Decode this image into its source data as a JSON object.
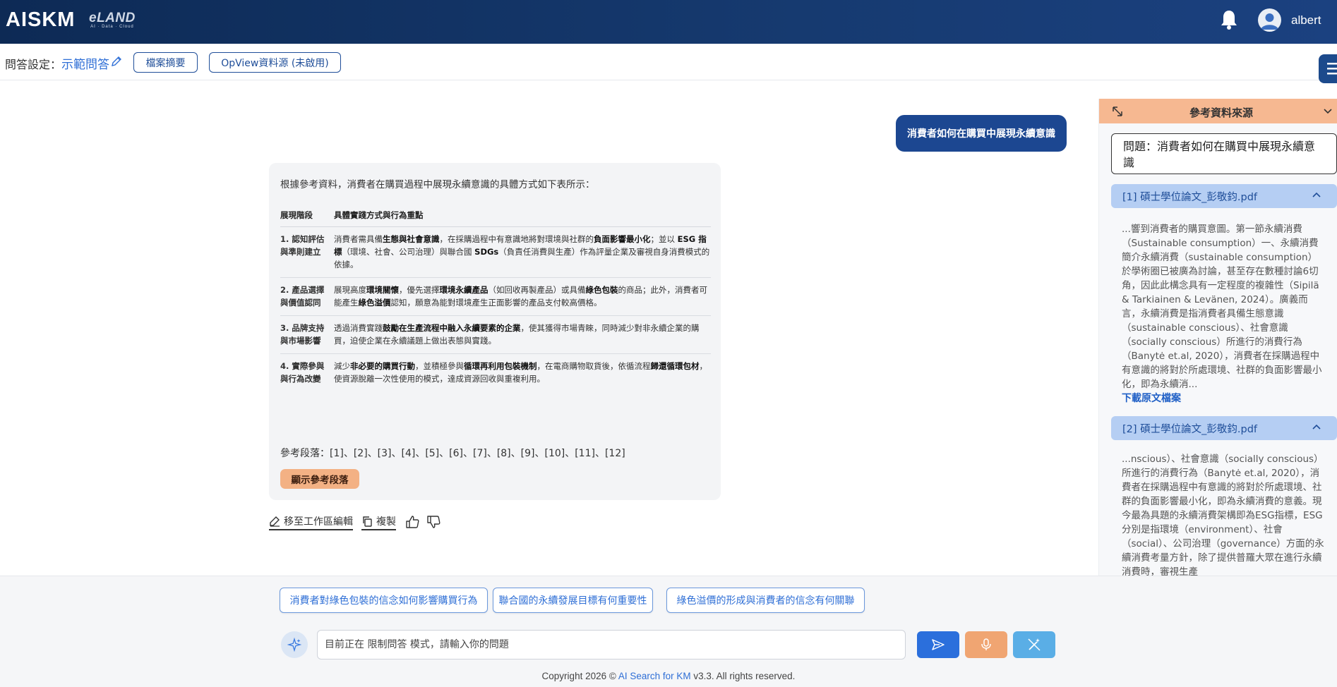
{
  "header": {
    "logo": "AISKM",
    "brand": "eLAND",
    "brand_tagline": "AI · Data · Cloud",
    "username": "albert"
  },
  "settings": {
    "label": "問答設定：",
    "mode_link": "示範問答",
    "summary_button": "檔案摘要",
    "opview_button": "OpView資料源 (未啟用)"
  },
  "chat": {
    "user_question": "消費者如何在購買中展現永續意識",
    "answer_intro": "根據參考資料，消費者在購買過程中展現永續意識的具體方式如下表所示：",
    "table_headers": [
      "展現階段",
      "具體實踐方式與行為重點"
    ],
    "rows": [
      {
        "stage": "1. 認知評估與準則建立",
        "parts": [
          {
            "t": "消費者需具備",
            "b": false
          },
          {
            "t": "生態與社會意識",
            "b": true
          },
          {
            "t": "，在採購過程中有意識地將對環境與社群的",
            "b": false
          },
          {
            "t": "負面影響最小化",
            "b": true
          },
          {
            "t": "；並以 ",
            "b": false
          },
          {
            "t": "ESG 指標",
            "b": true
          },
          {
            "t": "（環境、社會、公司治理）與聯合國 ",
            "b": false
          },
          {
            "t": "SDGs",
            "b": true
          },
          {
            "t": "（負責任消費與生產）作為評量企業及審視自身消費模式的依據。",
            "b": false
          }
        ]
      },
      {
        "stage": "2. 產品選擇與價值認同",
        "parts": [
          {
            "t": "展現高度",
            "b": false
          },
          {
            "t": "環境關懷",
            "b": true
          },
          {
            "t": "，優先選擇",
            "b": false
          },
          {
            "t": "環境永續產品",
            "b": true
          },
          {
            "t": "（如回收再製產品）或具備",
            "b": false
          },
          {
            "t": "綠色包裝",
            "b": true
          },
          {
            "t": "的商品；此外，消費者可能產生",
            "b": false
          },
          {
            "t": "綠色溢價",
            "b": true
          },
          {
            "t": "認知，願意為能對環境產生正面影響的產品支付較高價格。",
            "b": false
          }
        ]
      },
      {
        "stage": "3. 品牌支持與市場影響",
        "parts": [
          {
            "t": "透過消費實踐",
            "b": false
          },
          {
            "t": "鼓勵在生產流程中融入永續要素的企業",
            "b": true
          },
          {
            "t": "，使其獲得市場青睞，同時減少對非永續企業的購買，迫使企業在永續議題上做出表態與實踐。",
            "b": false
          }
        ]
      },
      {
        "stage": "4. 實際參與與行為改變",
        "parts": [
          {
            "t": "減少",
            "b": false
          },
          {
            "t": "非必要的購買行動",
            "b": true
          },
          {
            "t": "，並積極參與",
            "b": false
          },
          {
            "t": "循環再利用包裝機制",
            "b": true
          },
          {
            "t": "，在電商購物取貨後，依循流程",
            "b": false
          },
          {
            "t": "歸還循環包材",
            "b": true
          },
          {
            "t": "，使資源脫離一次性使用的模式，達成資源回收與重複利用。",
            "b": false
          }
        ]
      }
    ],
    "references": "參考段落：[1]、[2]、[3]、[4]、[5]、[6]、[7]、[8]、[9]、[10]、[11]、[12]",
    "show_refs_button": "顯示參考段落",
    "move_to_workspace": "移至工作區編輯",
    "copy": "複製"
  },
  "ref_panel": {
    "title": "參考資料來源",
    "question": "問題：消費者如何在購買中展現永續意識",
    "items": [
      {
        "title": "[1] 碩士學位論文_彭敬鈞.pdf",
        "text": "...響到消費者的購買意圖。第一節永續消費（Sustainable consumption）一、永續消費簡介永續消費（sustainable consumption）於學術圈已被廣為討論，甚至存在數種討論6切角，因此此構念具有一定程度的複雜性（Sipilä & Tarkiainen & Levänen, 2024）。廣義而言，永續消費是指消費者具備生態意識（sustainable conscious）、社會意識（socially conscious）所進行的消費行為（Banytė et.al, 2020），消費者在採購過程中有意識的將對於所處環境、社群的負面影響最小化，即為永續消...",
        "download": "下載原文檔案"
      },
      {
        "title": "[2] 碩士學位論文_彭敬鈞.pdf",
        "text": "...nscious）、社會意識（socially conscious）所進行的消費行為（Banytė et.al, 2020），消費者在採購過程中有意識的將對於所處環境、社群的負面影響最小化，即為永續消費的意義。現今最為具題的永續消費架構即為ESG指標，ESG分別是指環境（environment）、社會（social）、公司治理（governance）方面的永續消費考量方針，除了提供普羅大眾在進行永續消費時，審視生產"
      }
    ]
  },
  "bottom": {
    "suggestions": [
      "消費者對綠色包裝的信念如何影響購買行為",
      "聯合國的永續發展目標有何重要性",
      "綠色溢價的形成與消費者的信念有何關聯"
    ],
    "input_placeholder": "目前正在 限制問答 模式，請輸入你的問題",
    "footer_prefix": "Copyright 2026 © ",
    "footer_link": "AI Search for KM",
    "footer_suffix": " v3.3. All rights reserved."
  },
  "colors": {
    "topbar": "#163a70",
    "user_bubble": "#1c4791",
    "accent_orange": "#f3b184",
    "link_blue": "#2f6fd6"
  }
}
